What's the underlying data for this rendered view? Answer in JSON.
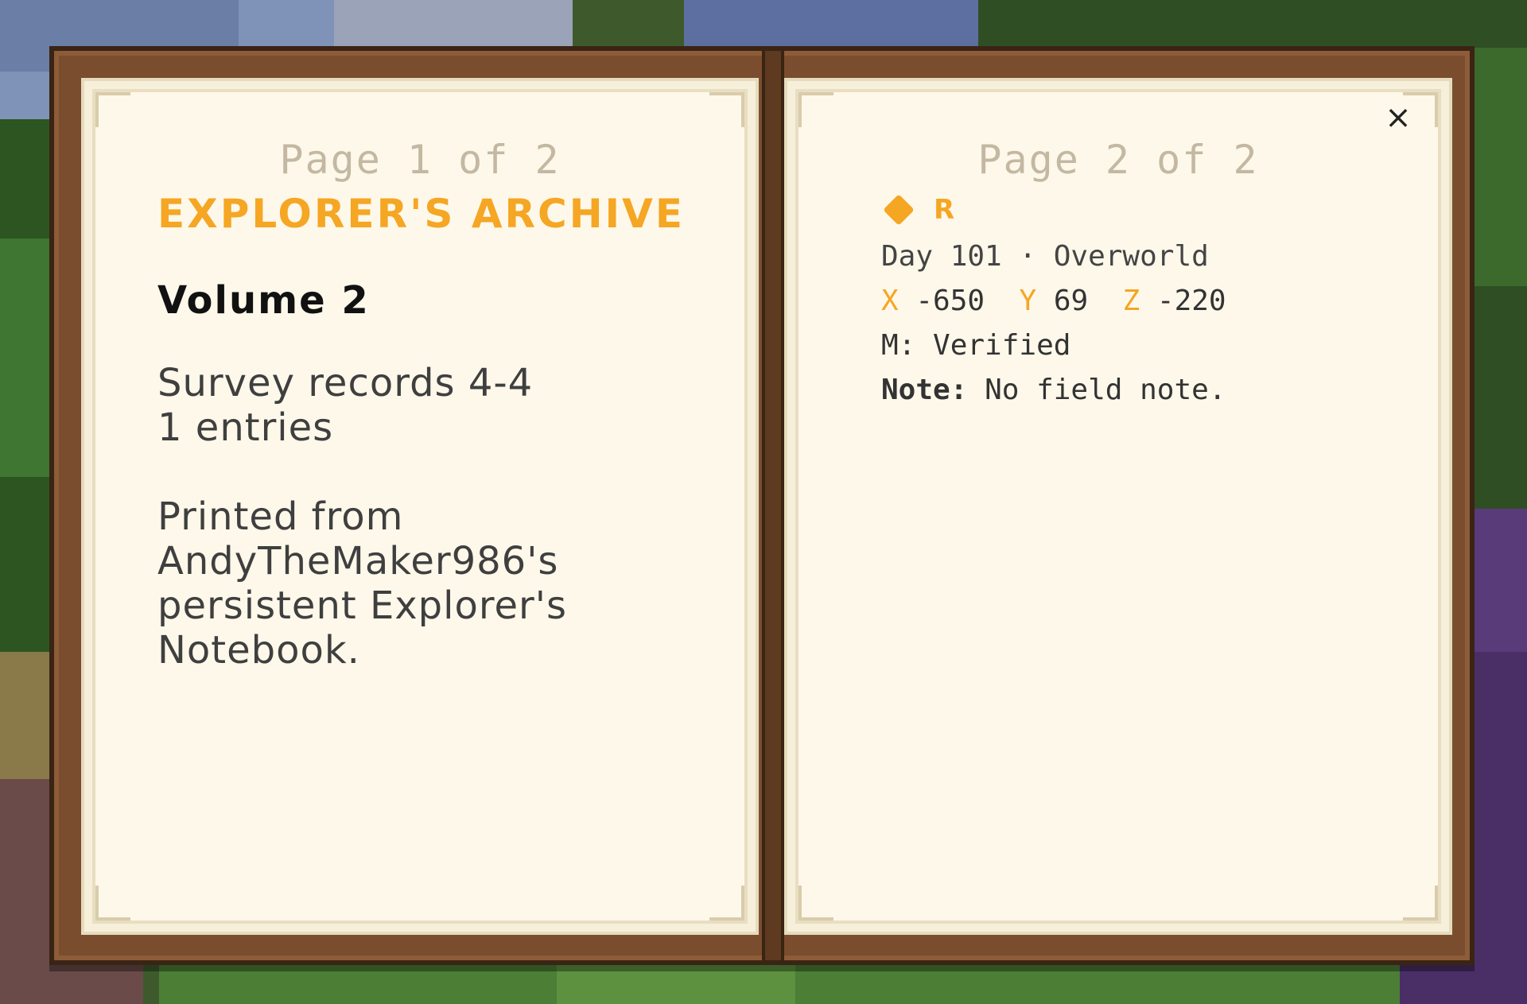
{
  "book": {
    "left_page": {
      "page_label": "Page 1 of 2",
      "title": "EXPLORER'S ARCHIVE",
      "volume": "Volume 2",
      "survey_line1": "Survey records 4-4",
      "survey_line2": "1 entries",
      "printed_line1": "Printed from",
      "printed_line2": "AndyTheMaker986's",
      "printed_line3": "persistent Explorer's",
      "printed_line4": "Notebook."
    },
    "right_page": {
      "page_label": "Page 2 of 2",
      "entry": {
        "icon": "orange-diamond-icon",
        "rarity": "R",
        "day_dimension": "Day 101 · Overworld",
        "x_label": "X",
        "x_value": "-650",
        "y_label": "Y",
        "y_value": "69",
        "z_label": "Z",
        "z_value": "-220",
        "status": "M: Verified",
        "note_label": "Note:",
        "note_text": "No field note."
      },
      "close_label": "×"
    }
  },
  "colors": {
    "accent": "#f5a623",
    "page": "#fdf8ea",
    "cover": "#7a4d2e",
    "page_label": "#c4b8a2"
  }
}
